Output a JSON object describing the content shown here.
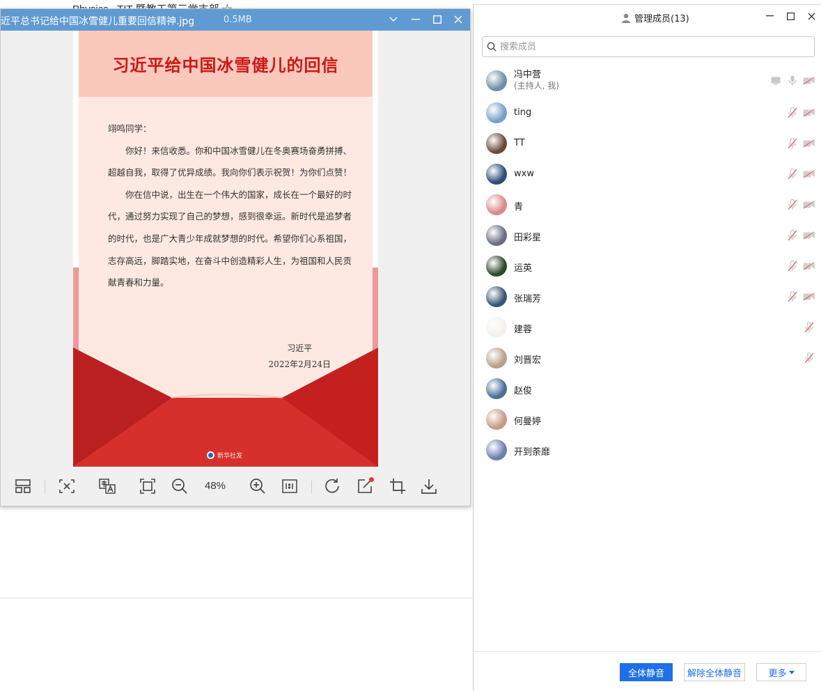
{
  "background": {
    "title": "Physics...TIT 暨教工第三党支部 ☆"
  },
  "viewer": {
    "filename": "近平总书记给中国冰雪健儿重要回信精神.jpg",
    "filesize": "0.5MB",
    "zoom": "48%",
    "letter": {
      "title": "习近平给中国冰雪健儿的回信",
      "salutation": "翊鸣同学：",
      "para1": "你好！来信收悉。你和中国冰雪健儿在冬奥赛场奋勇拼搏、超越自我，取得了优异成绩。我向你们表示祝贺！为你们点赞！",
      "para2": "你在信中说，出生在一个伟大的国家，成长在一个最好的时代，通过努力实现了自己的梦想，感到很幸运。新时代是追梦者的时代，也是广大青少年成就梦想的时代。希望你们心系祖国，志存高远，脚踏实地，在奋斗中创造精彩人生，为祖国和人民贡献青春和力量。",
      "signature": "习近平",
      "date": "2022年2月24日",
      "agency": "新华社发"
    }
  },
  "panel": {
    "title": "管理成员(13)",
    "search_placeholder": "搜索成员",
    "members": [
      {
        "name": "冯中营",
        "role": "(主持人, 我)",
        "avatar": "#6f8fa8",
        "screen": true,
        "mic": "on",
        "cam": "off"
      },
      {
        "name": "ting",
        "avatar": "#7aa0c8",
        "mic": "off",
        "cam": "off"
      },
      {
        "name": "TT",
        "avatar": "#6a4a3a",
        "mic": "off",
        "cam": "off"
      },
      {
        "name": "wxw",
        "avatar": "#2d4e78",
        "mic": "off",
        "cam": "off"
      },
      {
        "name": "青",
        "avatar": "#d98a8a",
        "mic": "off",
        "cam": "off"
      },
      {
        "name": "田彩星",
        "avatar": "#6b6e86",
        "mic": "off",
        "cam": "off"
      },
      {
        "name": "运英",
        "avatar": "#2f4a2a",
        "mic": "off",
        "cam": "off"
      },
      {
        "name": "张瑞芳",
        "avatar": "#3a5575",
        "mic": "off",
        "cam": "off"
      },
      {
        "name": "建蓉",
        "avatar": "#f4f1ec",
        "mic": "off"
      },
      {
        "name": "刘晋宏",
        "avatar": "#b8a08a",
        "mic": "off"
      },
      {
        "name": "赵俊",
        "avatar": "#4a6f9a"
      },
      {
        "name": "何曼婷",
        "avatar": "#c89a86"
      },
      {
        "name": "开到荼靡",
        "avatar": "#6c7fb3"
      }
    ],
    "buttons": {
      "mute_all": "全体静音",
      "unmute_all": "解除全体静音",
      "more": "更多"
    }
  }
}
